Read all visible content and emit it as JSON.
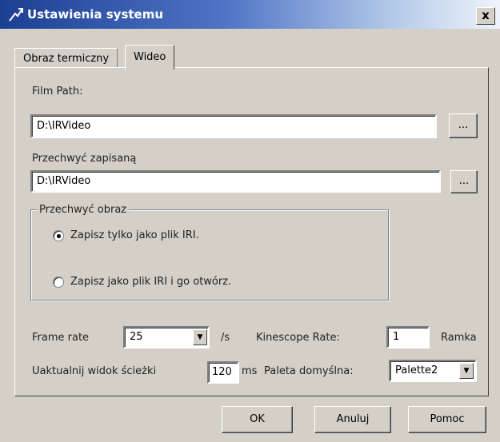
{
  "window": {
    "title": "Ustawienia systemu",
    "close_label": "x"
  },
  "tabs": [
    {
      "label": "Obraz termiczny",
      "active": false
    },
    {
      "label": "Wideo",
      "active": true
    }
  ],
  "film_path": {
    "label": "Film Path:",
    "value": "D:\\IRVideo",
    "browse_label": "..."
  },
  "capture_saved": {
    "label": "Przechwyć zapisaną",
    "value": "D:\\IRVideo",
    "browse_label": "..."
  },
  "capture_image": {
    "legend": "Przechwyć obraz",
    "options": [
      {
        "label": "Zapisz tylko jako plik IRI.",
        "selected": true
      },
      {
        "label": "Zapisz jako plik IRI i go otwórz.",
        "selected": false
      }
    ]
  },
  "frame_rate": {
    "label": "Frame rate",
    "value": "25",
    "unit": "/s"
  },
  "kinescope_rate": {
    "label": "Kinescope Rate:",
    "value": "1",
    "unit": "Ramka"
  },
  "refresh_track": {
    "label": "Uaktualnij widok ścieżki",
    "value": "120",
    "unit": "ms"
  },
  "default_palette": {
    "label": "Paleta domyślna:",
    "value": "Palette2"
  },
  "buttons": {
    "ok": "OK",
    "cancel": "Anuluj",
    "help": "Pomoc"
  },
  "colors": {
    "title_bar": "#1c3f93",
    "face": "#d4d0c8"
  },
  "icons": {
    "app": "ir-camera-icon",
    "combo": "chevron-down-icon"
  }
}
